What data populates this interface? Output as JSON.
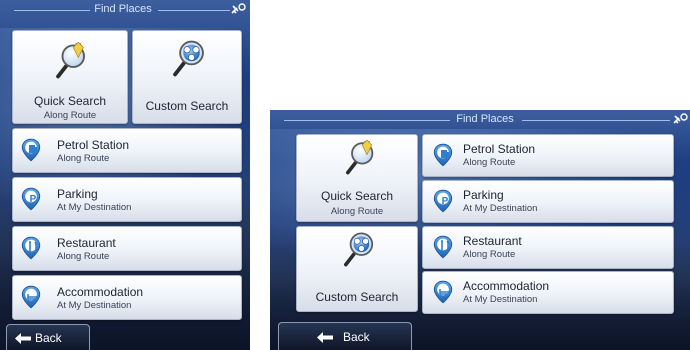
{
  "header": {
    "title": "Find Places"
  },
  "icons": {
    "status": "satellite-gps-icon",
    "quick_search": "magnifier-pin-icon",
    "custom_search": "magnifier-globe-icon",
    "petrol_station": "fuel-pump-pin-icon",
    "parking": "parking-p-pin-icon",
    "restaurant": "fork-knife-pin-icon",
    "accommodation": "bed-pin-icon",
    "back": "left-arrow-icon"
  },
  "buttons": {
    "quick_search": {
      "label": "Quick Search",
      "sublabel": "Along Route"
    },
    "custom_search": {
      "label": "Custom Search"
    },
    "petrol_station": {
      "label": "Petrol Station",
      "sublabel": "Along Route"
    },
    "parking": {
      "label": "Parking",
      "sublabel": "At My Destination"
    },
    "restaurant": {
      "label": "Restaurant",
      "sublabel": "Along Route"
    },
    "accommodation": {
      "label": "Accommodation",
      "sublabel": "At My Destination"
    }
  },
  "footer": {
    "back_label": "Back"
  },
  "colors": {
    "pin_blue": "#2f7fd0",
    "background_blue": "#213f7b",
    "button_face": "#eef2f8"
  }
}
